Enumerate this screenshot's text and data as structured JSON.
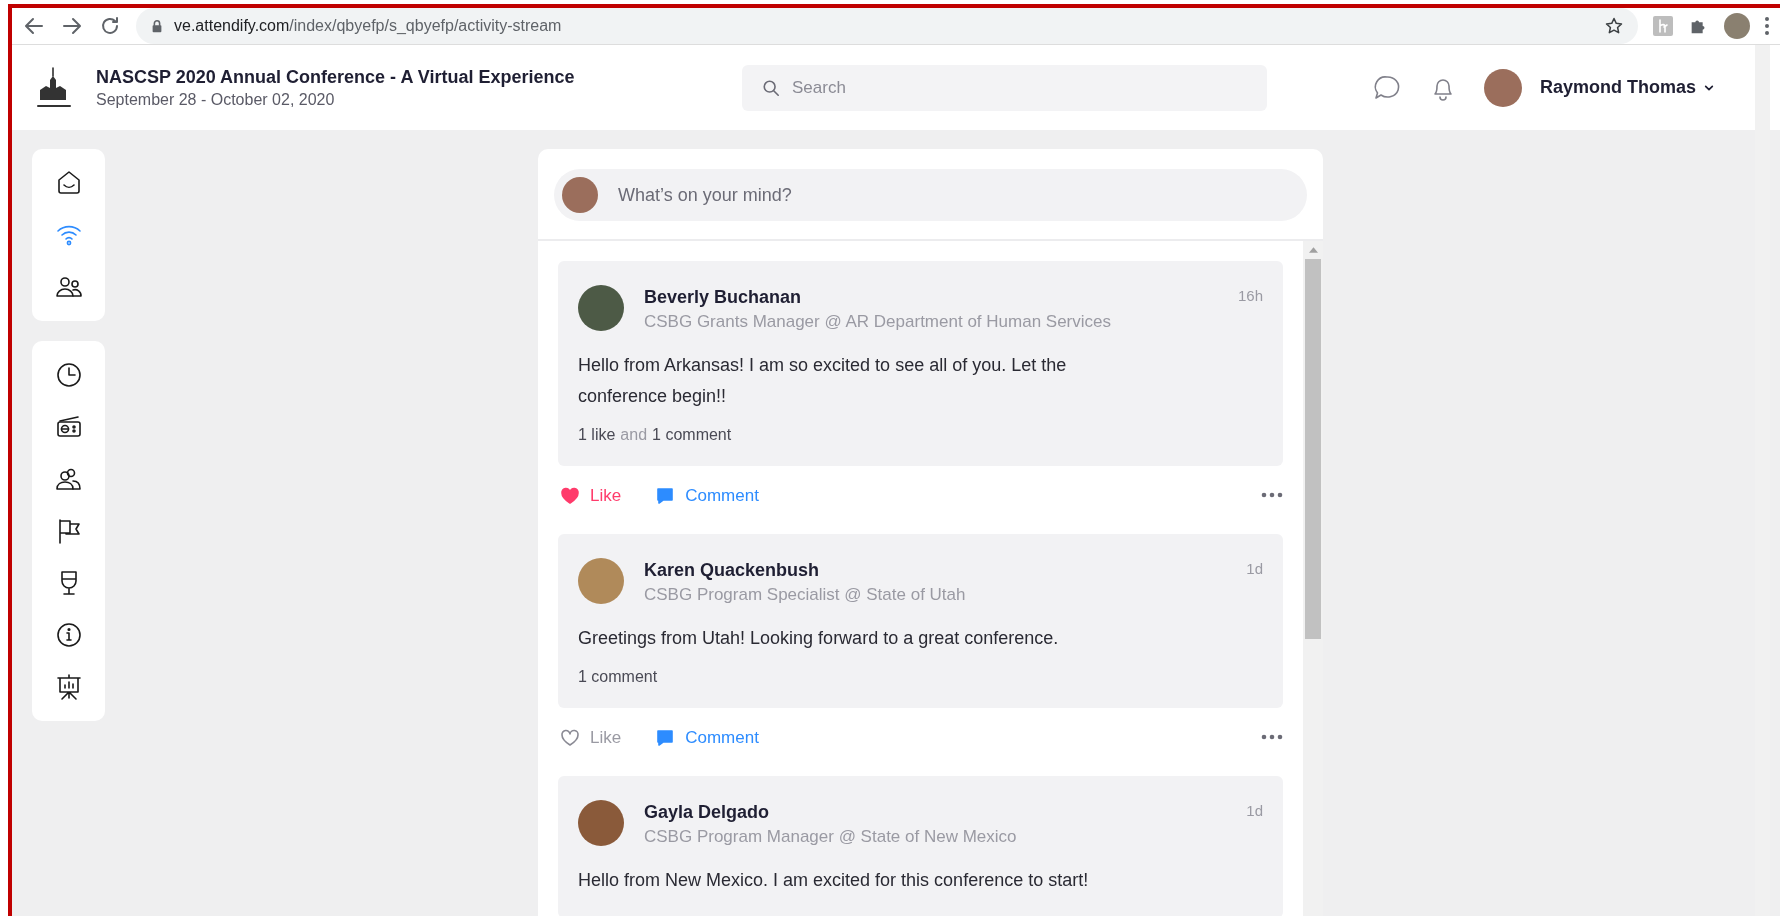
{
  "browser": {
    "url_host": "ve.attendify.com",
    "url_path": "/index/qbyefp/s_qbyefp/activity-stream"
  },
  "header": {
    "title": "NASCSP 2020 Annual Conference - A Virtual Experience",
    "dates": "September 28 - October 02, 2020",
    "search": {
      "placeholder": "Search"
    },
    "user_name": "Raymond Thomas"
  },
  "sidebar": {
    "groups": [
      {
        "items": [
          {
            "kind": "home",
            "selected": false
          },
          {
            "kind": "wifi",
            "selected": true
          },
          {
            "kind": "people",
            "selected": false
          }
        ]
      },
      {
        "items": [
          {
            "kind": "clock",
            "selected": false
          },
          {
            "kind": "radio",
            "selected": false
          },
          {
            "kind": "persons",
            "selected": false
          },
          {
            "kind": "flag",
            "selected": false
          },
          {
            "kind": "glass",
            "selected": false
          },
          {
            "kind": "info",
            "selected": false
          },
          {
            "kind": "easel",
            "selected": false
          }
        ]
      }
    ]
  },
  "composer": {
    "placeholder": "What’s on your mind?"
  },
  "posts": [
    {
      "name": "Beverly Buchanan",
      "role": "CSBG Grants Manager @ AR Department of Human Services",
      "time": "16h",
      "text": "Hello from Arkansas! I am so excited to see all of you. Let the conference begin!!",
      "stats": [
        {
          "kind": "count",
          "text": "1 like"
        },
        {
          "kind": "joiner",
          "text": "and"
        },
        {
          "kind": "count",
          "text": "1 comment"
        }
      ],
      "actions": {
        "like": "Like",
        "liked": true,
        "comment": "Comment"
      }
    },
    {
      "name": "Karen Quackenbush",
      "role": "CSBG Program Specialist @ State of Utah",
      "time": "1d",
      "text": "Greetings from Utah! Looking forward to a great conference.",
      "stats": [
        {
          "kind": "count",
          "text": "1 comment"
        }
      ],
      "actions": {
        "like": "Like",
        "liked": false,
        "comment": "Comment"
      }
    },
    {
      "name": "Gayla Delgado",
      "role": "CSBG Program Manager @ State of New Mexico",
      "time": "1d",
      "text": "Hello from New Mexico. I am excited for this conference to start!"
    }
  ]
}
